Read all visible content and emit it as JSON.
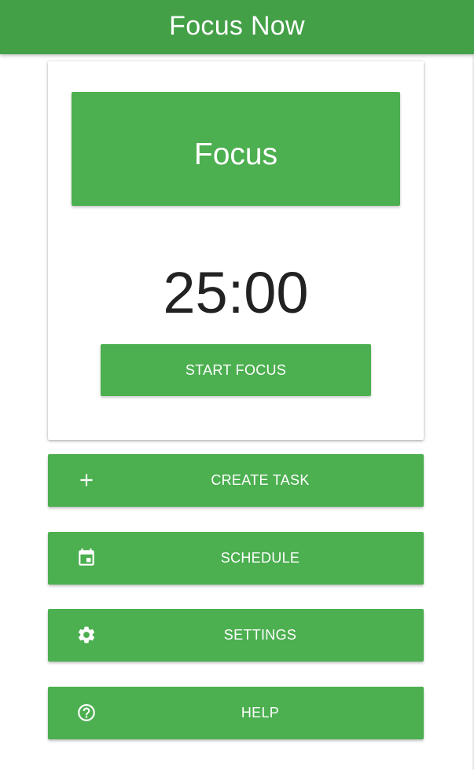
{
  "app_bar": {
    "title": "Focus Now",
    "color": "#43a047"
  },
  "timer_card": {
    "mode_label": "Focus",
    "time_remaining": "25:00",
    "start_label": "START FOCUS"
  },
  "actions": [
    {
      "label": "CREATE TASK",
      "icon": "plus-icon"
    },
    {
      "label": "SCHEDULE",
      "icon": "calendar-icon"
    },
    {
      "label": "SETTINGS",
      "icon": "gear-icon"
    },
    {
      "label": "HELP",
      "icon": "help-circle-icon"
    }
  ],
  "colors": {
    "accent": "#4caf50",
    "header": "#43a047",
    "text_dark": "#222222"
  }
}
